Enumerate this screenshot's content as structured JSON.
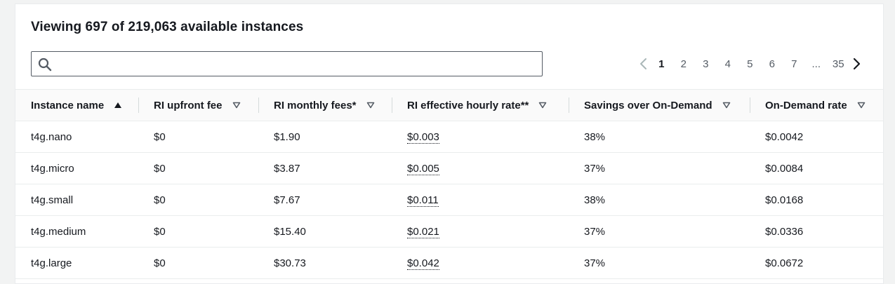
{
  "title": "Viewing 697 of 219,063 available instances",
  "search": {
    "placeholder": "",
    "value": ""
  },
  "pagination": {
    "current": "1",
    "pages": [
      "1",
      "2",
      "3",
      "4",
      "5",
      "6",
      "7"
    ],
    "ellipsis": "...",
    "last": "35"
  },
  "columns": [
    {
      "label": "Instance name",
      "sort_icon": "sort-ascending-icon"
    },
    {
      "label": "RI upfront fee",
      "sort_icon": "sort-descending-icon"
    },
    {
      "label": "RI monthly fees*",
      "sort_icon": "sort-descending-icon"
    },
    {
      "label": "RI effective hourly rate**",
      "sort_icon": "sort-descending-icon"
    },
    {
      "label": "Savings over On-Demand",
      "sort_icon": "sort-descending-icon"
    },
    {
      "label": "On-Demand rate",
      "sort_icon": "sort-descending-icon"
    }
  ],
  "rows": [
    {
      "name": "t4g.nano",
      "upfront": "$0",
      "monthly": "$1.90",
      "effective": "$0.003",
      "savings": "38%",
      "ondemand": "$0.0042"
    },
    {
      "name": "t4g.micro",
      "upfront": "$0",
      "monthly": "$3.87",
      "effective": "$0.005",
      "savings": "37%",
      "ondemand": "$0.0084"
    },
    {
      "name": "t4g.small",
      "upfront": "$0",
      "monthly": "$7.67",
      "effective": "$0.011",
      "savings": "38%",
      "ondemand": "$0.0168"
    },
    {
      "name": "t4g.medium",
      "upfront": "$0",
      "monthly": "$15.40",
      "effective": "$0.021",
      "savings": "37%",
      "ondemand": "$0.0336"
    },
    {
      "name": "t4g.large",
      "upfront": "$0",
      "monthly": "$30.73",
      "effective": "$0.042",
      "savings": "37%",
      "ondemand": "$0.0672"
    }
  ]
}
